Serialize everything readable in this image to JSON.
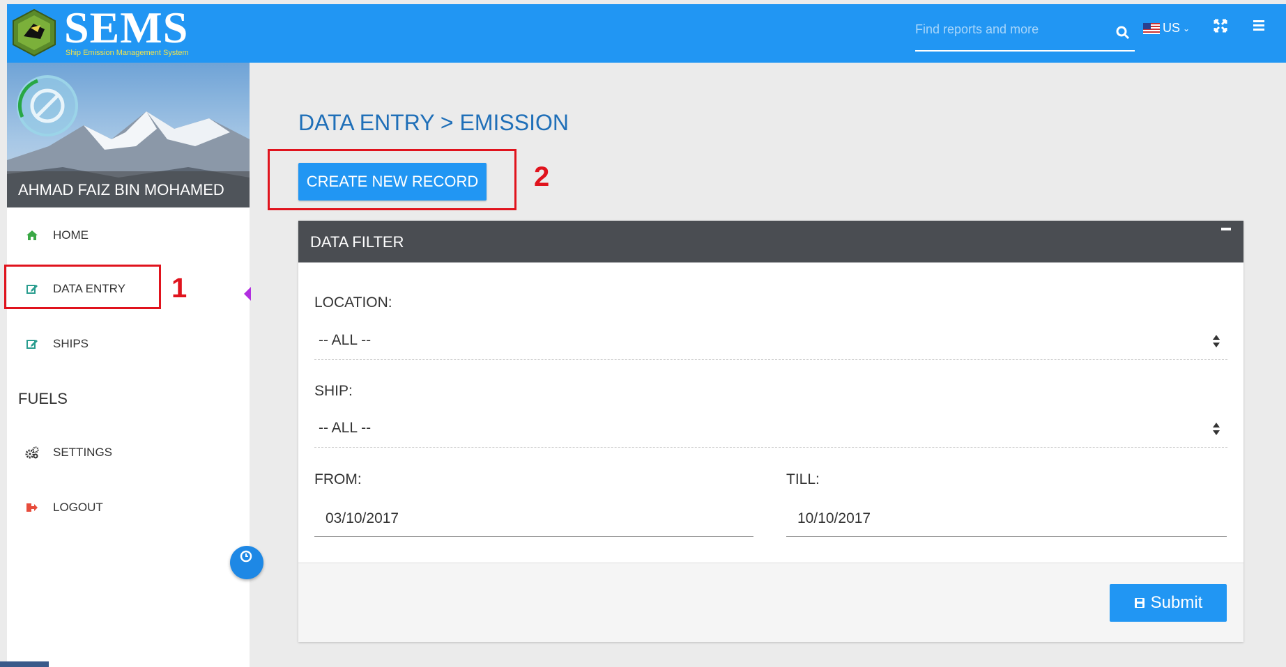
{
  "app": {
    "logo_title": "SEMS",
    "logo_subtitle": "Ship Emission Management System"
  },
  "header": {
    "search_placeholder": "Find reports and more",
    "language": "US"
  },
  "user": {
    "name": "AHMAD FAIZ BIN MOHAMED"
  },
  "sidebar": {
    "items": [
      {
        "label": "HOME",
        "icon": "home-icon"
      },
      {
        "label": "DATA ENTRY",
        "icon": "edit-icon"
      },
      {
        "label": "SHIPS",
        "icon": "edit-icon"
      },
      {
        "label": "FUELS"
      },
      {
        "label": "SETTINGS",
        "icon": "cogs-icon"
      },
      {
        "label": "LOGOUT",
        "icon": "sign-out-icon"
      }
    ]
  },
  "annotations": {
    "one": "1",
    "two": "2"
  },
  "main": {
    "breadcrumb": "DATA ENTRY > EMISSION",
    "create_button": "CREATE NEW RECORD"
  },
  "filter": {
    "title": "DATA FILTER",
    "location_label": "LOCATION:",
    "location_value": "-- ALL --",
    "ship_label": "SHIP:",
    "ship_value": "-- ALL --",
    "from_label": "FROM:",
    "from_value": "03/10/2017",
    "till_label": "TILL:",
    "till_value": "10/10/2017",
    "submit_label": "Submit"
  },
  "colors": {
    "primary": "#2196f3",
    "panel_header": "#4a4d52",
    "annotation": "#e0131d",
    "breadcrumb": "#1f6fb8"
  }
}
